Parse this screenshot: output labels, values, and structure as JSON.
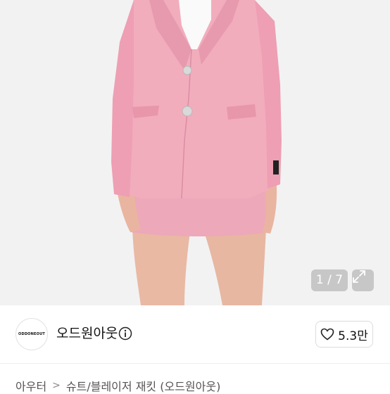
{
  "gallery": {
    "current_page": "1",
    "total_pages": "7",
    "counter_text": "1 / 7"
  },
  "seller": {
    "avatar_logo_text": "ODDONEOUT",
    "name": "오드원아웃"
  },
  "like": {
    "count": "5.3만"
  },
  "breadcrumb": {
    "items": [
      "아우터",
      "슈트/블레이저 재킷 (오드원아웃)"
    ],
    "separator": ">"
  },
  "colors": {
    "jacket": "#f2adbd",
    "background": "#f2f2f3",
    "text": "#111111"
  }
}
